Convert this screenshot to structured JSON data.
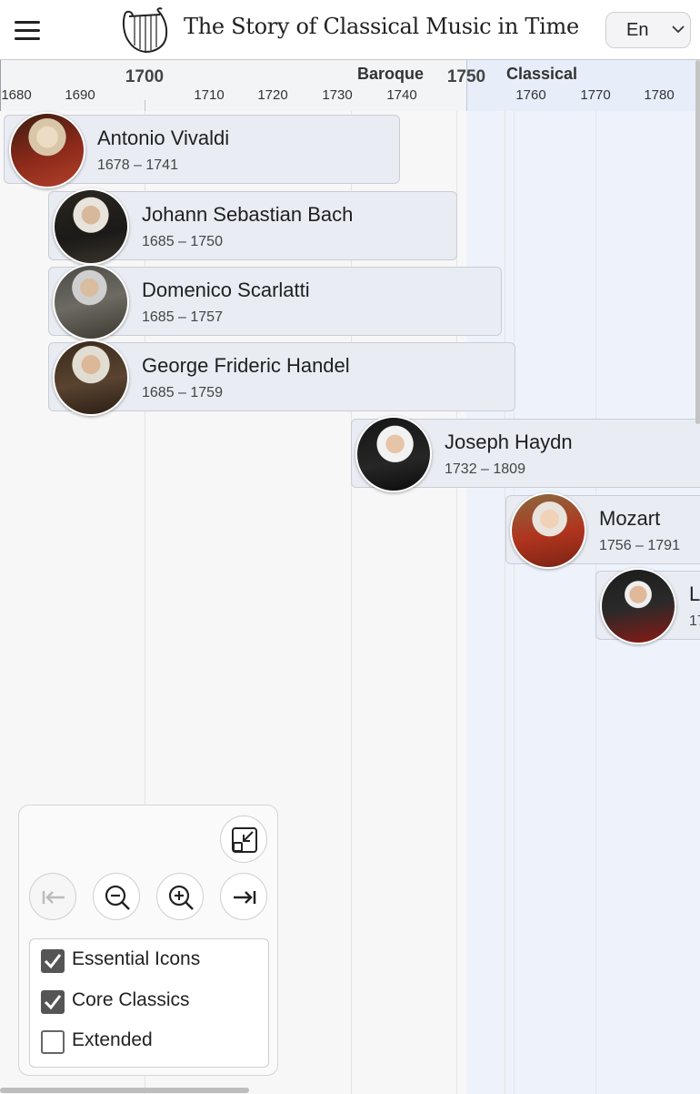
{
  "header": {
    "title": "The Story of Classical Music in Time",
    "language": "En",
    "menu_icon": "hamburger-menu-icon",
    "logo_icon": "lyre-icon"
  },
  "timeline": {
    "eras": [
      {
        "label": "Baroque",
        "color": "#f7f7f7"
      },
      {
        "label": "Classical",
        "color": "#eef3fb"
      }
    ],
    "major_years": [
      "1700",
      "1750"
    ],
    "minor_years": [
      "1680",
      "1690",
      "1710",
      "1720",
      "1730",
      "1740",
      "1760",
      "1770",
      "1780"
    ]
  },
  "composers": [
    {
      "name": "Antonio Vivaldi",
      "years": "1678 – 1741"
    },
    {
      "name": "Johann Sebastian Bach",
      "years": "1685 – 1750"
    },
    {
      "name": "Domenico Scarlatti",
      "years": "1685 – 1757"
    },
    {
      "name": "George Frideric Handel",
      "years": "1685 – 1759"
    },
    {
      "name": "Joseph Haydn",
      "years": "1732 – 1809"
    },
    {
      "name": "Mozart",
      "years": "1756 – 1791"
    },
    {
      "name": "L",
      "years": "17"
    }
  ],
  "controls": {
    "buttons": [
      "fit-to-screen-icon",
      "jump-to-start-icon",
      "zoom-out-icon",
      "zoom-in-icon",
      "jump-to-end-icon"
    ],
    "filters": [
      {
        "label": "Essential Icons",
        "checked": true
      },
      {
        "label": "Core Classics",
        "checked": true
      },
      {
        "label": "Extended",
        "checked": false
      }
    ]
  }
}
